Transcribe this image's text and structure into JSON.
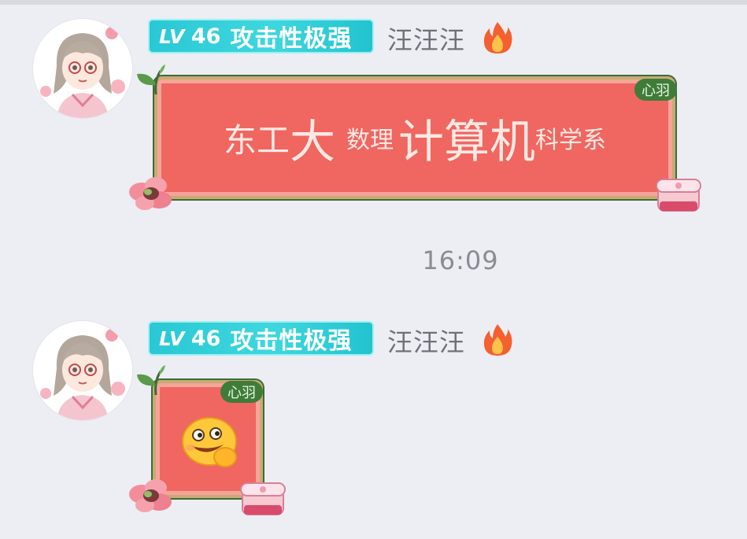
{
  "messages": [
    {
      "level_prefix": "LV",
      "level_number": "46",
      "rank_title": "攻击性极强",
      "nickname": "汪汪汪",
      "bubble_tag": "心羽",
      "text_parts": [
        "东工",
        "大",
        "数理",
        "计算机",
        "科学系"
      ]
    },
    {
      "level_prefix": "LV",
      "level_number": "46",
      "rank_title": "攻击性极强",
      "nickname": "汪汪汪",
      "bubble_tag": "心羽",
      "sticker": "grinning-peach-emoji-sticker"
    }
  ],
  "timestamp": "16:09",
  "icons": {
    "avatar": "anime-girl-avatar-icon",
    "streak": "flame-icon",
    "leaf": "leaf-icon",
    "flower": "flower-icon",
    "box": "gift-box-icon"
  },
  "colors": {
    "background": "#ededf4",
    "badge": "#29c8d4",
    "bubble": "#f06660",
    "bubble_border": "#c8ab74",
    "tag": "#3f7c3a",
    "nickname": "#6f7178",
    "timestamp": "#8a8c93"
  }
}
